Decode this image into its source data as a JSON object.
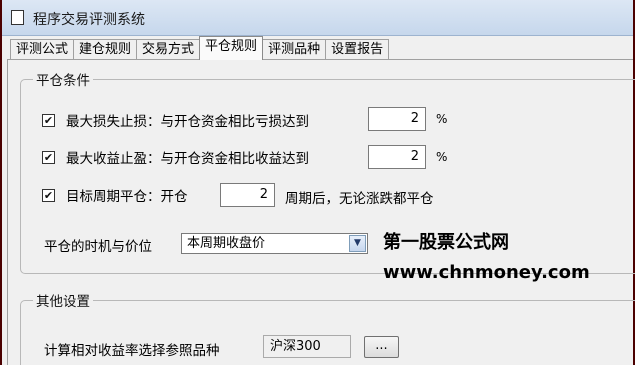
{
  "window": {
    "title": "程序交易评测系统"
  },
  "tabs": [
    {
      "label": "评测公式"
    },
    {
      "label": "建仓规则"
    },
    {
      "label": "交易方式"
    },
    {
      "label": "平仓规则",
      "active": true
    },
    {
      "label": "评测品种"
    },
    {
      "label": "设置报告"
    }
  ],
  "close_group": {
    "legend": "平仓条件",
    "max_loss": {
      "checked": true,
      "label": "最大损失止损：与开仓资金相比亏损达到",
      "value": "2",
      "unit": "%"
    },
    "max_profit": {
      "checked": true,
      "label": "最大收益止盈：与开仓资金相比收益达到",
      "value": "2",
      "unit": "%"
    },
    "target_period": {
      "checked": true,
      "label": "目标周期平仓：开仓",
      "value": "2",
      "suffix": "周期后，无论涨跌都平仓"
    },
    "timing": {
      "label": "平仓的时机与价位",
      "selected": "本周期收盘价"
    }
  },
  "other_group": {
    "legend": "其他设置",
    "reference": {
      "label": "计算相对收益率选择参照品种",
      "value": "沪深300",
      "browse_label": "..."
    }
  },
  "watermark": {
    "line1": "第一股票公式网",
    "line2": "www.chnmoney.com"
  },
  "icons": {
    "checkbox_mark": "check-icon",
    "dropdown": "chevron-down-icon",
    "window": "window-icon"
  }
}
